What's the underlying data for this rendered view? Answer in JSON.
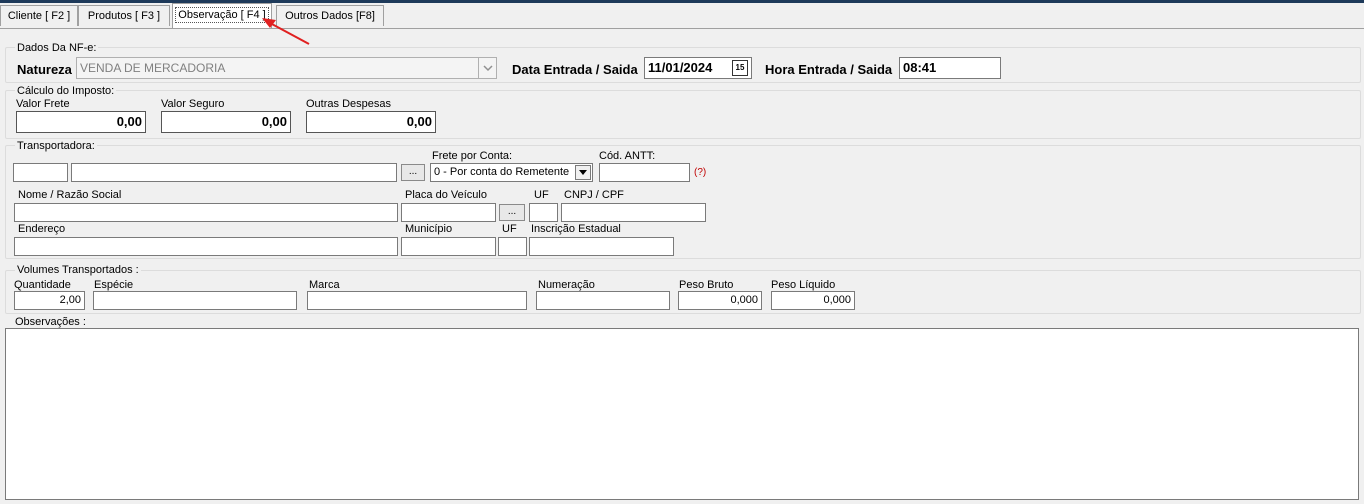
{
  "tabs": [
    "Cliente [ F2 ]",
    "Produtos [ F3 ]",
    "Observação [ F4 ]",
    "Outros Dados [F8]"
  ],
  "active_tab": "Observação [ F4 ]",
  "dados_nfe": {
    "title": "Dados Da NF-e:",
    "natureza_label": "Natureza",
    "natureza_value": "VENDA DE MERCADORIA",
    "data_label": "Data Entrada / Saida",
    "data_value": "11/01/2024",
    "hora_label": "Hora Entrada / Saida",
    "hora_value": "08:41"
  },
  "calculo": {
    "title": "Cálculo do Imposto:",
    "frete_label": "Valor Frete",
    "frete_value": "0,00",
    "seguro_label": "Valor Seguro",
    "seguro_value": "0,00",
    "outras_label": "Outras Despesas",
    "outras_value": "0,00"
  },
  "transportadora": {
    "title": "Transportadora:",
    "lookup_button": "...",
    "frete_conta_label": "Frete por Conta:",
    "frete_conta_value": "0 - Por conta do Remetente",
    "antt_label": "Cód. ANTT:",
    "antt_help": "(?)",
    "nome_label": "Nome / Razão Social",
    "placa_label": "Placa do Veículo",
    "placa_button": "...",
    "uf_label": "UF",
    "cnpj_label": "CNPJ / CPF",
    "endereco_label": "Endereço",
    "municipio_label": "Município",
    "uf2_label": "UF",
    "ie_label": "Inscrição Estadual"
  },
  "volumes": {
    "title": "Volumes Transportados :",
    "quantidade_label": "Quantidade",
    "quantidade_value": "2,00",
    "especie_label": "Espécie",
    "marca_label": "Marca",
    "numeracao_label": "Numeração",
    "peso_bruto_label": "Peso Bruto",
    "peso_bruto_value": "0,000",
    "peso_liquido_label": "Peso Líquido",
    "peso_liquido_value": "0,000"
  },
  "observacoes": {
    "title": "Observações :"
  },
  "colors": {
    "annotation_arrow": "#e02020",
    "help_text": "#c00000",
    "top_bar": "#1e3a5a"
  }
}
